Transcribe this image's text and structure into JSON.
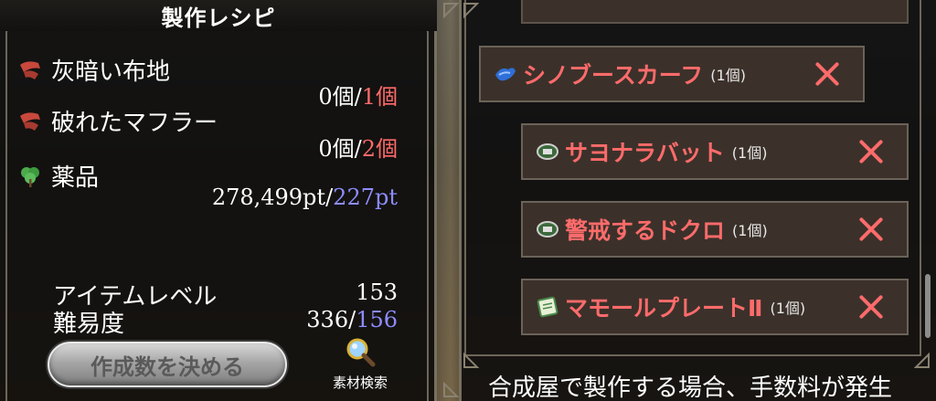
{
  "left_panel": {
    "title": "製作レシピ",
    "materials": [
      {
        "name": "灰暗い布地",
        "have": "0個",
        "sep": "/",
        "need": "1個",
        "icon": "cloth-icon"
      },
      {
        "name": "破れたマフラー",
        "have": "0個",
        "sep": "/",
        "need": "2個",
        "icon": "cloth-icon"
      },
      {
        "name": "薬品",
        "have": "278,499pt",
        "sep": "/",
        "need": "227pt",
        "icon": "herb-icon"
      }
    ],
    "stats": {
      "item_level_label": "アイテムレベル",
      "item_level_value": "153",
      "difficulty_label": "難易度",
      "difficulty_have": "336",
      "difficulty_sep": "/",
      "difficulty_need": "156"
    },
    "decide_button": "作成数を決める",
    "search_button": "素材検索"
  },
  "right_panel": {
    "items": [
      {
        "name": "シノブースカーフ",
        "count": "(1個)",
        "icon": "scarf-icon"
      },
      {
        "name": "サヨナラバット",
        "count": "(1個)",
        "icon": "box-icon"
      },
      {
        "name": "警戒するドクロ",
        "count": "(1個)",
        "icon": "box-icon"
      },
      {
        "name": "マモールプレートⅡ",
        "count": "(1個)",
        "icon": "scroll-icon"
      }
    ],
    "message": "合成屋で製作する場合、手数料が発生"
  },
  "colors": {
    "need_red": "#ff6a6a",
    "need_blue": "#8d8cff",
    "item_name": "#ff6b6b"
  }
}
